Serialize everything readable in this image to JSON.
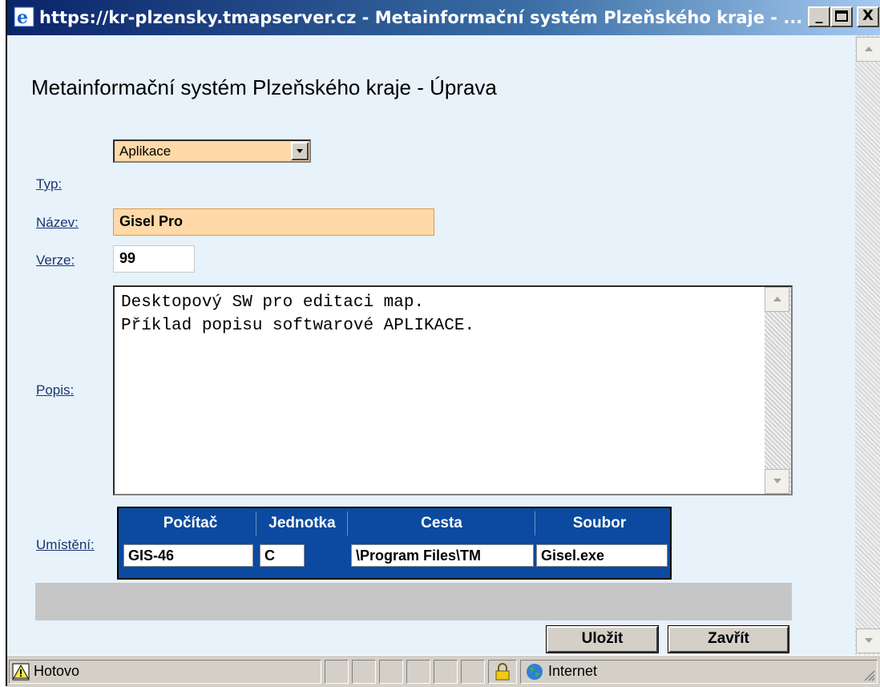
{
  "window": {
    "title": "https://kr-plzensky.tmapserver.cz - Metainformační systém Plzeňského kraje - ..."
  },
  "form": {
    "heading": "Metainformační systém Plzeňského kraje - Úprava",
    "typ_label": "Typ:",
    "typ_value": "Aplikace",
    "nazev_label": "Název:",
    "nazev_value": "Gisel Pro",
    "verze_label": "Verze:",
    "verze_value": "99",
    "popis_label": "Popis:",
    "popis_value": "Desktopový SW pro editaci map.\nPříklad popisu softwarové APLIKACE.",
    "umisteni_label": "Umístění:",
    "location": {
      "headers": [
        "Počítač",
        "Jednotka",
        "Cesta",
        "Soubor"
      ],
      "values": [
        "GIS-46",
        "C",
        "\\Program Files\\TM",
        "Gisel.exe"
      ]
    }
  },
  "buttons": {
    "save": "Uložit",
    "close": "Zavřít"
  },
  "status": {
    "text": "Hotovo",
    "zone": "Internet"
  },
  "colors": {
    "accent_field": "#ffd9a8",
    "location_bg": "#0b4aa0",
    "content_bg": "#e7f2fb"
  },
  "icons": [
    "ie-icon",
    "minimize-icon",
    "maximize-icon",
    "close-icon",
    "warning-icon",
    "lock-icon",
    "globe-icon"
  ]
}
